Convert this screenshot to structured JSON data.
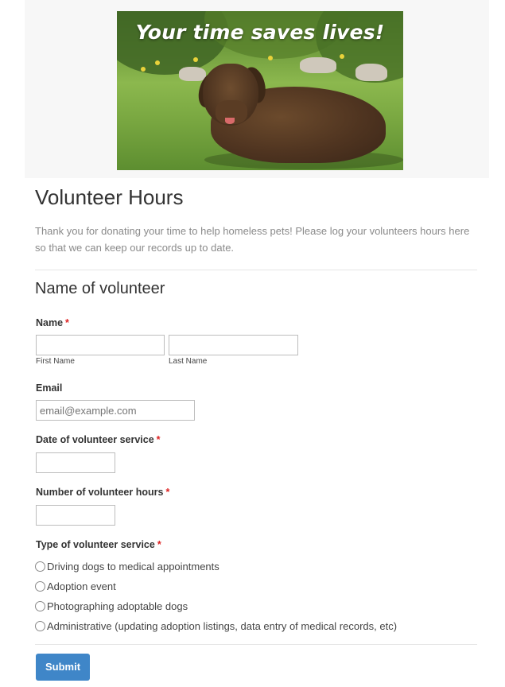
{
  "hero": {
    "text": "Your time saves lives!"
  },
  "page": {
    "title": "Volunteer Hours",
    "intro": "Thank you for donating your time to help homeless pets! Please log your volunteers hours here so that we can keep our records up to date."
  },
  "section": {
    "heading": "Name of volunteer"
  },
  "fields": {
    "name": {
      "label": "Name",
      "required_mark": "*",
      "first_value": "",
      "last_value": "",
      "first_sublabel": "First Name",
      "last_sublabel": "Last Name"
    },
    "email": {
      "label": "Email",
      "value": "",
      "placeholder": "email@example.com"
    },
    "date": {
      "label": "Date of volunteer service",
      "required_mark": "*",
      "value": ""
    },
    "hours": {
      "label": "Number of volunteer hours",
      "required_mark": "*",
      "value": ""
    },
    "service_type": {
      "label": "Type of volunteer service",
      "required_mark": "*",
      "options": [
        "Driving dogs to medical appointments",
        "Adoption event",
        "Photographing adoptable dogs",
        "Administrative (updating adoption listings, data entry of medical records, etc)"
      ]
    }
  },
  "actions": {
    "submit_label": "Submit"
  },
  "colors": {
    "accent": "#3f86c8",
    "required": "#dd2222"
  }
}
